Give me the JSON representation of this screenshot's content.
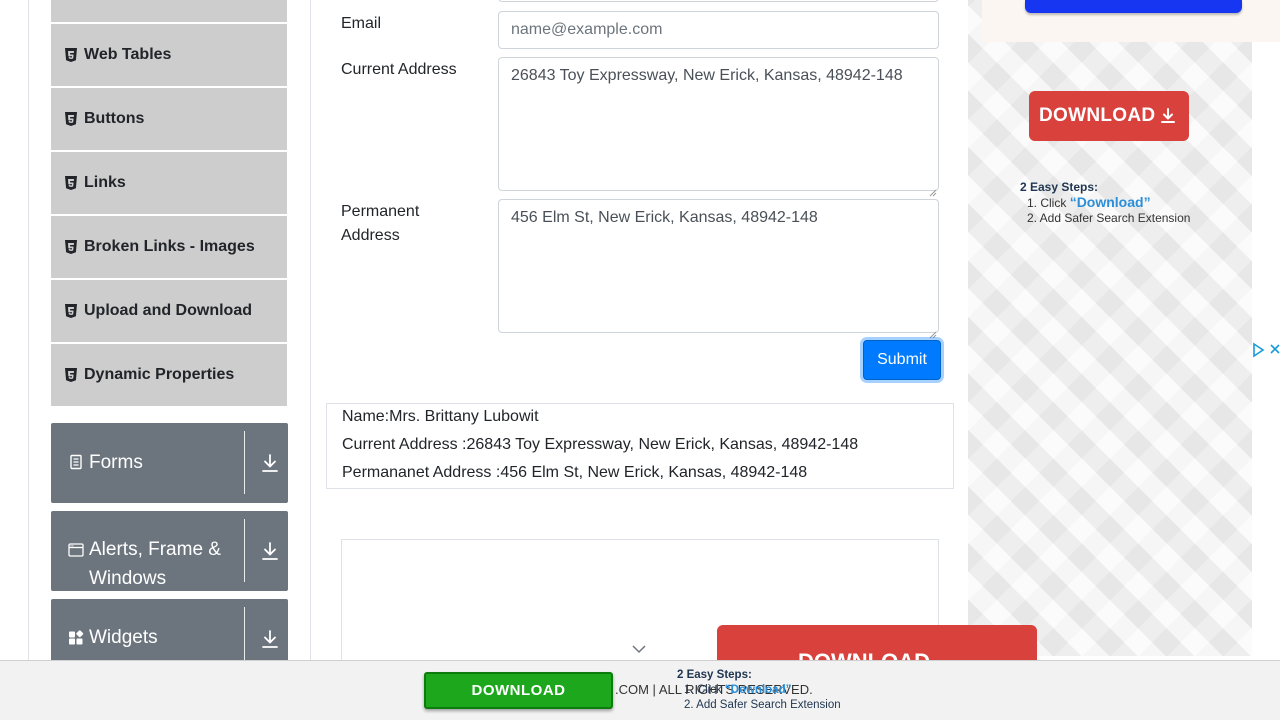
{
  "sidebar": {
    "elements_items": [
      {
        "label": ""
      },
      {
        "label": "Web Tables"
      },
      {
        "label": "Buttons"
      },
      {
        "label": "Links"
      },
      {
        "label": "Broken Links - Images"
      },
      {
        "label": "Upload and Download"
      },
      {
        "label": "Dynamic Properties"
      }
    ],
    "groups": [
      {
        "title": "Forms",
        "icon": "form-icon"
      },
      {
        "title": "Alerts, Frame & Windows",
        "icon": "window-icon"
      },
      {
        "title": "Widgets",
        "icon": "widgets-icon"
      }
    ]
  },
  "form": {
    "email_label": "Email",
    "email_placeholder": "name@example.com",
    "email_value": "",
    "current_address_label": "Current Address",
    "current_address_value": "26843 Toy Expressway, New Erick, Kansas, 48942-148",
    "permanent_address_label": "Permanent Address",
    "permanent_address_value": "456 Elm St, New Erick, Kansas, 48942-148",
    "submit_label": "Submit"
  },
  "output": {
    "name": "Name:Mrs. Brittany Lubowit",
    "current_address": "Current Address :26843 Toy Expressway, New Erick, Kansas, 48942-148",
    "permanent_address": "Permananet Address :456 Elm St, New Erick, Kansas, 48942-148"
  },
  "ad": {
    "download_label": "DOWNLOAD",
    "steps_title": "2 Easy Steps:",
    "step1_prefix": "1. Click ",
    "step1_highlight": "“Download”",
    "step2": "2. Add Safer Search Extension",
    "bottom_download_label": "DOWNLOAD",
    "footer_download_label": "DOWNLOAD",
    "footer_copyright": ".COM | ALL RIGHTS RESERVED.",
    "accent_red": "#d9413c",
    "accent_green": "#1ca71c",
    "accent_blue": "#1736f2"
  },
  "colors": {
    "menu_item_bg": "#cdcdcd",
    "group_bg": "#6c757d",
    "primary": "#007bff"
  }
}
